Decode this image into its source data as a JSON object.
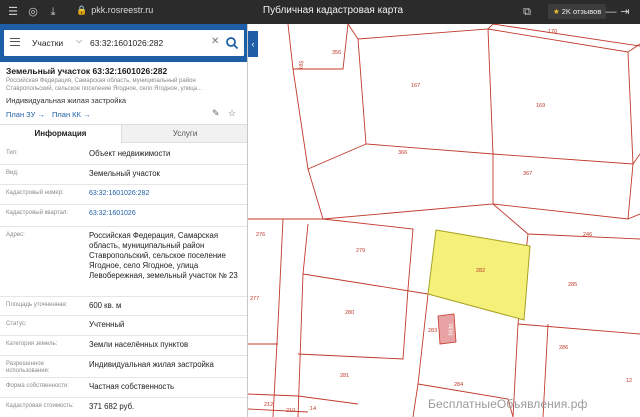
{
  "browser": {
    "url": "pkk.rosreestr.ru",
    "title": "Публичная кадастровая карта",
    "reviews": "2K отзывов"
  },
  "search": {
    "mode": "Участки",
    "query": "63:32:1601026:282"
  },
  "object": {
    "title": "Земельный участок 63:32:1601026:282",
    "address_short": "Российская Федерация, Самарская область, муниципальный район Ставропольский, сельское поселение Ягодное, село Ягодное, улица...",
    "use": "Индивидуальная жилая застройка",
    "plan_zu": "План ЗУ →",
    "plan_kk": "План КК →"
  },
  "tabs": {
    "info": "Информация",
    "services": "Услуги"
  },
  "info": [
    {
      "label": "Тип:",
      "value": "Объект недвижимости"
    },
    {
      "label": "Вид:",
      "value": "Земельный участок"
    },
    {
      "label": "Кадастровый номер:",
      "value": "63:32:1601026:282"
    },
    {
      "label": "Кадастровый квартал:",
      "value": "63:32:1601026"
    },
    {
      "label": "Адрес:",
      "value": "Российская Федерация, Самарская область, муниципальный район Ставропольский, сельское поселение Ягодное, село Ягодное, улица Левобережная, земельный участок № 23"
    },
    {
      "label": "Площадь уточненная:",
      "value": "600 кв. м"
    },
    {
      "label": "Статус:",
      "value": "Учтенный"
    },
    {
      "label": "Категория земель:",
      "value": "Земли населённых пунктов"
    },
    {
      "label": "Разрешенное использование:",
      "value": "Индивидуальная жилая застройка"
    },
    {
      "label": "Форма собственности:",
      "value": "Частная собственность"
    },
    {
      "label": "Кадастровая стоимость:",
      "value": "371 682 руб."
    }
  ],
  "map": {
    "parcel_numbers": [
      "170",
      "356",
      "165",
      "167",
      "169",
      "366",
      "367",
      "276",
      "279",
      "246",
      "282",
      "285",
      "277",
      "280",
      "286",
      "283",
      "281",
      "284",
      "212",
      "210",
      "14",
      "12"
    ],
    "building_label": "1630",
    "highlight_color": "#f4f07a",
    "line_color": "#c0392b"
  },
  "watermark": "БесплатныеОбъявления.рф"
}
